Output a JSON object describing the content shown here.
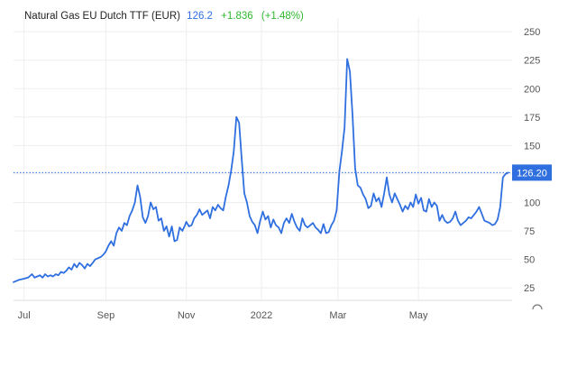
{
  "chart_data": {
    "type": "line",
    "title": "Natural Gas EU Dutch TTF (EUR)",
    "last_price": "126.2",
    "change": "+1.836",
    "change_pct": "(+1.48%)",
    "price_tag": "126.20",
    "last_value": 126.2,
    "ylim": [
      14,
      262
    ],
    "yticks": [
      25,
      50,
      75,
      100,
      125,
      150,
      175,
      200,
      225,
      250
    ],
    "x_labels": [
      {
        "label": "Jul",
        "day": 8
      },
      {
        "label": "Sep",
        "day": 70
      },
      {
        "label": "Nov",
        "day": 131
      },
      {
        "label": "2022",
        "day": 188
      },
      {
        "label": "Mar",
        "day": 246
      },
      {
        "label": "May",
        "day": 307
      }
    ],
    "x_range": [
      0,
      378
    ],
    "grid": true,
    "colors": {
      "line": "#2f6fe0",
      "grid": "#eeeeee",
      "axis": "#555555",
      "tag_bg": "#2f6fe0"
    },
    "series": [
      {
        "x": [
          0,
          4,
          8,
          11,
          14,
          16,
          18,
          20,
          22,
          24,
          26,
          28,
          30,
          32,
          34,
          36,
          38,
          40,
          42,
          44,
          46,
          48,
          50,
          52,
          54,
          56,
          58,
          60,
          62,
          64,
          66,
          68,
          70,
          72,
          74,
          76,
          78,
          80,
          82,
          84,
          86,
          88,
          90,
          92,
          94,
          96,
          98,
          100,
          102,
          104,
          106,
          108,
          110,
          112,
          114,
          116,
          118,
          120,
          122,
          124,
          126,
          128,
          130,
          131,
          133,
          135,
          137,
          139,
          141,
          143,
          145,
          147,
          149,
          151,
          153,
          155,
          157,
          159,
          161,
          163,
          165,
          167,
          169,
          171,
          173,
          175,
          177,
          179,
          181,
          183,
          185,
          187,
          189,
          191,
          193,
          195,
          197,
          199,
          201,
          203,
          205,
          207,
          209,
          211,
          213,
          215,
          217,
          219,
          221,
          223,
          225,
          227,
          229,
          231,
          233,
          235,
          237,
          239,
          241,
          243,
          245,
          247,
          249,
          251,
          253,
          255,
          257,
          259,
          261,
          263,
          265,
          267,
          269,
          271,
          273,
          275,
          277,
          279,
          281,
          283,
          285,
          287,
          289,
          291,
          293,
          295,
          297,
          299,
          301,
          303,
          305,
          307,
          309,
          311,
          313,
          315,
          317,
          319,
          321,
          323,
          325,
          327,
          329,
          331,
          333,
          335,
          337,
          339,
          341,
          343,
          345
        ],
        "y": [
          30,
          32,
          33,
          34,
          37,
          34,
          35,
          36,
          34,
          37,
          35,
          36,
          35,
          37,
          36,
          39,
          38,
          40,
          43,
          41,
          46,
          43,
          47,
          45,
          42,
          46,
          44,
          47,
          50,
          51,
          52,
          54,
          57,
          62,
          66,
          62,
          73,
          78,
          75,
          82,
          80,
          88,
          93,
          100,
          115,
          105,
          87,
          82,
          88,
          100,
          94,
          96,
          84,
          86,
          75,
          79,
          70,
          79,
          66,
          67,
          78,
          75,
          80,
          83,
          79,
          80,
          86,
          89,
          94,
          89,
          91,
          93,
          86,
          96,
          93,
          98,
          95,
          93,
          105,
          115,
          128,
          145,
          175,
          170,
          138,
          108,
          100,
          88,
          83,
          80,
          73,
          84,
          92,
          85,
          88,
          78,
          85,
          80,
          78,
          73,
          82,
          86,
          82,
          90,
          83,
          78,
          75,
          86,
          80,
          78,
          80,
          82,
          78,
          76,
          73,
          81,
          73,
          74,
          80,
          84,
          93,
          127,
          145,
          166,
          226,
          215,
          177,
          130,
          115,
          113,
          107,
          103,
          95,
          97,
          108,
          101,
          104,
          96,
          108,
          122,
          107,
          100,
          108,
          103,
          98,
          92,
          97,
          94,
          100,
          96,
          107,
          99,
          104,
          93,
          92,
          103,
          96,
          100,
          97,
          84,
          89,
          84,
          82,
          83,
          86,
          92,
          84,
          80,
          82,
          84,
          87
        ]
      },
      {
        "x": [
          345,
          347,
          349,
          351,
          353,
          355,
          357,
          359,
          361,
          363,
          365,
          367,
          369,
          371,
          373,
          375
        ],
        "y": [
          87,
          86,
          89,
          92,
          96,
          90,
          84,
          83,
          82,
          80,
          81,
          85,
          96,
          122,
          125,
          126.2
        ]
      }
    ]
  }
}
